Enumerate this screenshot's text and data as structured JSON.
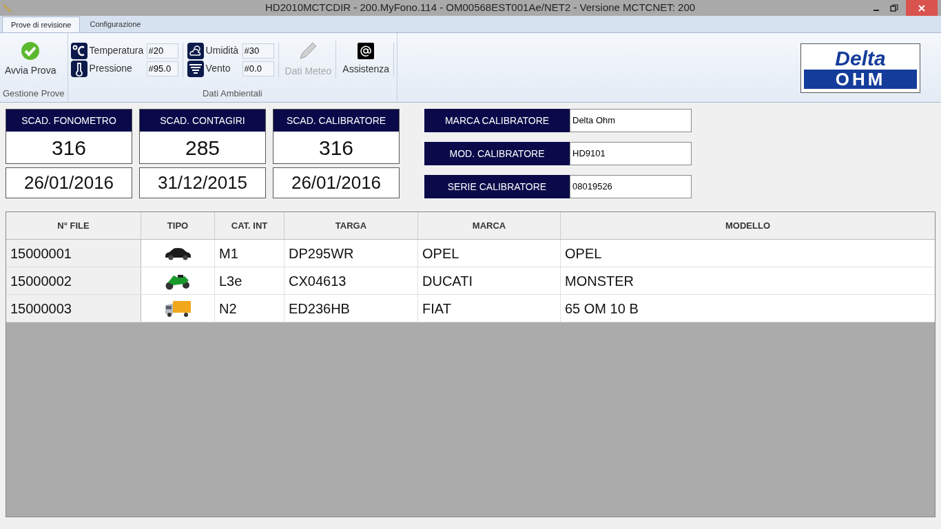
{
  "window": {
    "title": "HD2010MCTCDIR - 200.MyFono.114 - OM00568EST001Ae/NET2 - Versione MCTCNET: 200"
  },
  "tabs": [
    {
      "label": "Prove di revisione",
      "selected": true
    },
    {
      "label": "Configurazione",
      "selected": false
    }
  ],
  "ribbon": {
    "groups": [
      {
        "title": "Gestione Prove",
        "kind": "buttons",
        "buttons": [
          {
            "label": "Avvia Prova",
            "disabled": false
          }
        ]
      },
      {
        "title": "Dati Ambientali",
        "kind": "fields",
        "fields": [
          {
            "label": "Temperatura",
            "value": "#20"
          },
          {
            "label": "Pressione",
            "value": "#95.0"
          },
          {
            "label": "Umidità",
            "value": "#30"
          },
          {
            "label": "Vento",
            "value": "#0.0"
          }
        ],
        "buttons": [
          {
            "label": "Dati Meteo",
            "disabled": true
          },
          {
            "label": "Assistenza",
            "disabled": false
          }
        ]
      }
    ]
  },
  "logo": {
    "top": "Delta",
    "bottom": "OHM"
  },
  "expiry_cards": [
    {
      "title": "SCAD. FONOMETRO",
      "days": "316",
      "date": "26/01/2016"
    },
    {
      "title": "SCAD. CONTAGIRI",
      "days": "285",
      "date": "31/12/2015"
    },
    {
      "title": "SCAD. CALIBRATORE",
      "days": "316",
      "date": "26/01/2016"
    }
  ],
  "calibrator": [
    {
      "label": "MARCA CALIBRATORE",
      "value": "Delta Ohm"
    },
    {
      "label": "MOD. CALIBRATORE",
      "value": "HD9101"
    },
    {
      "label": "SERIE CALIBRATORE",
      "value": "08019526"
    }
  ],
  "table": {
    "columns": [
      "N° FILE",
      "TIPO",
      "CAT. INT",
      "TARGA",
      "MARCA",
      "MODELLO"
    ],
    "rows": [
      {
        "file": "15000001",
        "kind": "car",
        "cat": "M1",
        "plate": "DP295WR",
        "brand": "OPEL",
        "model": "OPEL"
      },
      {
        "file": "15000002",
        "kind": "motorcycle",
        "cat": "L3e",
        "plate": "CX04613",
        "brand": "DUCATI",
        "model": "MONSTER"
      },
      {
        "file": "15000003",
        "kind": "truck",
        "cat": "N2",
        "plate": "ED236HB",
        "brand": "FIAT",
        "model": "65 OM 10 B"
      }
    ]
  }
}
